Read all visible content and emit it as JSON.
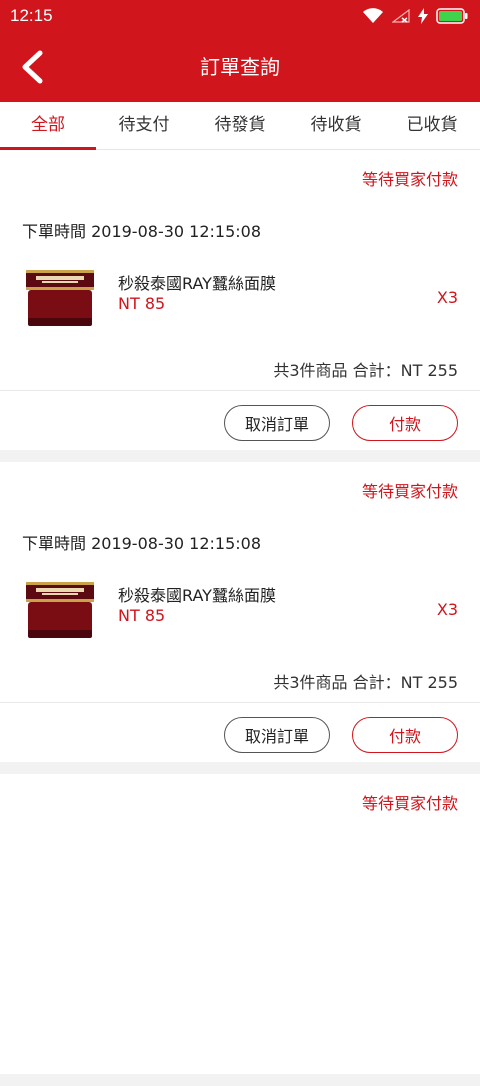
{
  "statusbar": {
    "time": "12:15"
  },
  "appbar": {
    "title": "訂單查詢"
  },
  "tabs": [
    {
      "label": "全部",
      "active": true
    },
    {
      "label": "待支付",
      "active": false
    },
    {
      "label": "待發貨",
      "active": false
    },
    {
      "label": "待收貨",
      "active": false
    },
    {
      "label": "已收貨",
      "active": false
    }
  ],
  "orders": [
    {
      "status": "等待買家付款",
      "order_time": "下單時間 2019-08-30 12:15:08",
      "product_name": "秒殺泰國RAY蠶絲面膜",
      "price": "NT 85",
      "quantity": "X3",
      "summary": "共3件商品 合計：NT 255",
      "cancel_label": "取消訂單",
      "pay_label": "付款"
    },
    {
      "status": "等待買家付款",
      "order_time": "下單時間 2019-08-30 12:15:08",
      "product_name": "秒殺泰國RAY蠶絲面膜",
      "price": "NT 85",
      "quantity": "X3",
      "summary": "共3件商品 合計：NT 255",
      "cancel_label": "取消訂單",
      "pay_label": "付款"
    },
    {
      "status": "等待買家付款",
      "order_time": "",
      "product_name": "",
      "price": "",
      "quantity": "",
      "summary": "",
      "cancel_label": "",
      "pay_label": ""
    }
  ],
  "colors": {
    "brand": "#d0151c"
  },
  "icons": {
    "back": "back-arrow-icon",
    "wifi": "wifi-icon",
    "signal": "signal-icon",
    "charging": "charging-icon",
    "battery": "battery-icon"
  }
}
